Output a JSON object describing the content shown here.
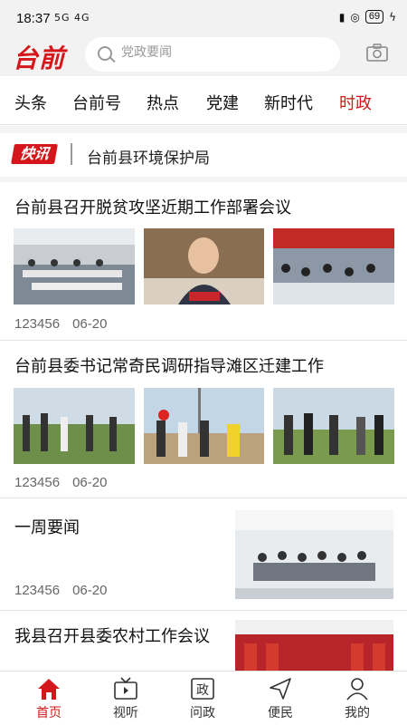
{
  "status": {
    "time": "18:37",
    "signal": "5G 4G",
    "battery": "69"
  },
  "header": {
    "logo": "台前",
    "search_placeholder": "党政要闻",
    "camera_icon": "camera-icon"
  },
  "tabs": [
    {
      "label": "头条"
    },
    {
      "label": "台前号"
    },
    {
      "label": "热点"
    },
    {
      "label": "党建"
    },
    {
      "label": "新时代"
    },
    {
      "label": "时政",
      "active": true
    }
  ],
  "flash": {
    "badge": "快讯",
    "text": "台前县环境保护局"
  },
  "articles": [
    {
      "title": "台前县召开脱贫攻坚近期工作部署会议",
      "views": "123456",
      "date": "06-20"
    },
    {
      "title": "台前县委书记常奇民调研指导滩区迁建工作",
      "views": "123456",
      "date": "06-20"
    },
    {
      "title": "一周要闻",
      "views": "123456",
      "date": "06-20"
    },
    {
      "title": "我县召开县委农村工作会议"
    }
  ],
  "bottom_nav": [
    {
      "label": "首页",
      "icon": "home-icon",
      "active": true
    },
    {
      "label": "视听",
      "icon": "tv-icon"
    },
    {
      "label": "问政",
      "icon": "politics-icon"
    },
    {
      "label": "便民",
      "icon": "send-icon"
    },
    {
      "label": "我的",
      "icon": "user-icon"
    }
  ],
  "colors": {
    "accent": "#d5171b",
    "text": "#111111",
    "muted": "#666666"
  }
}
